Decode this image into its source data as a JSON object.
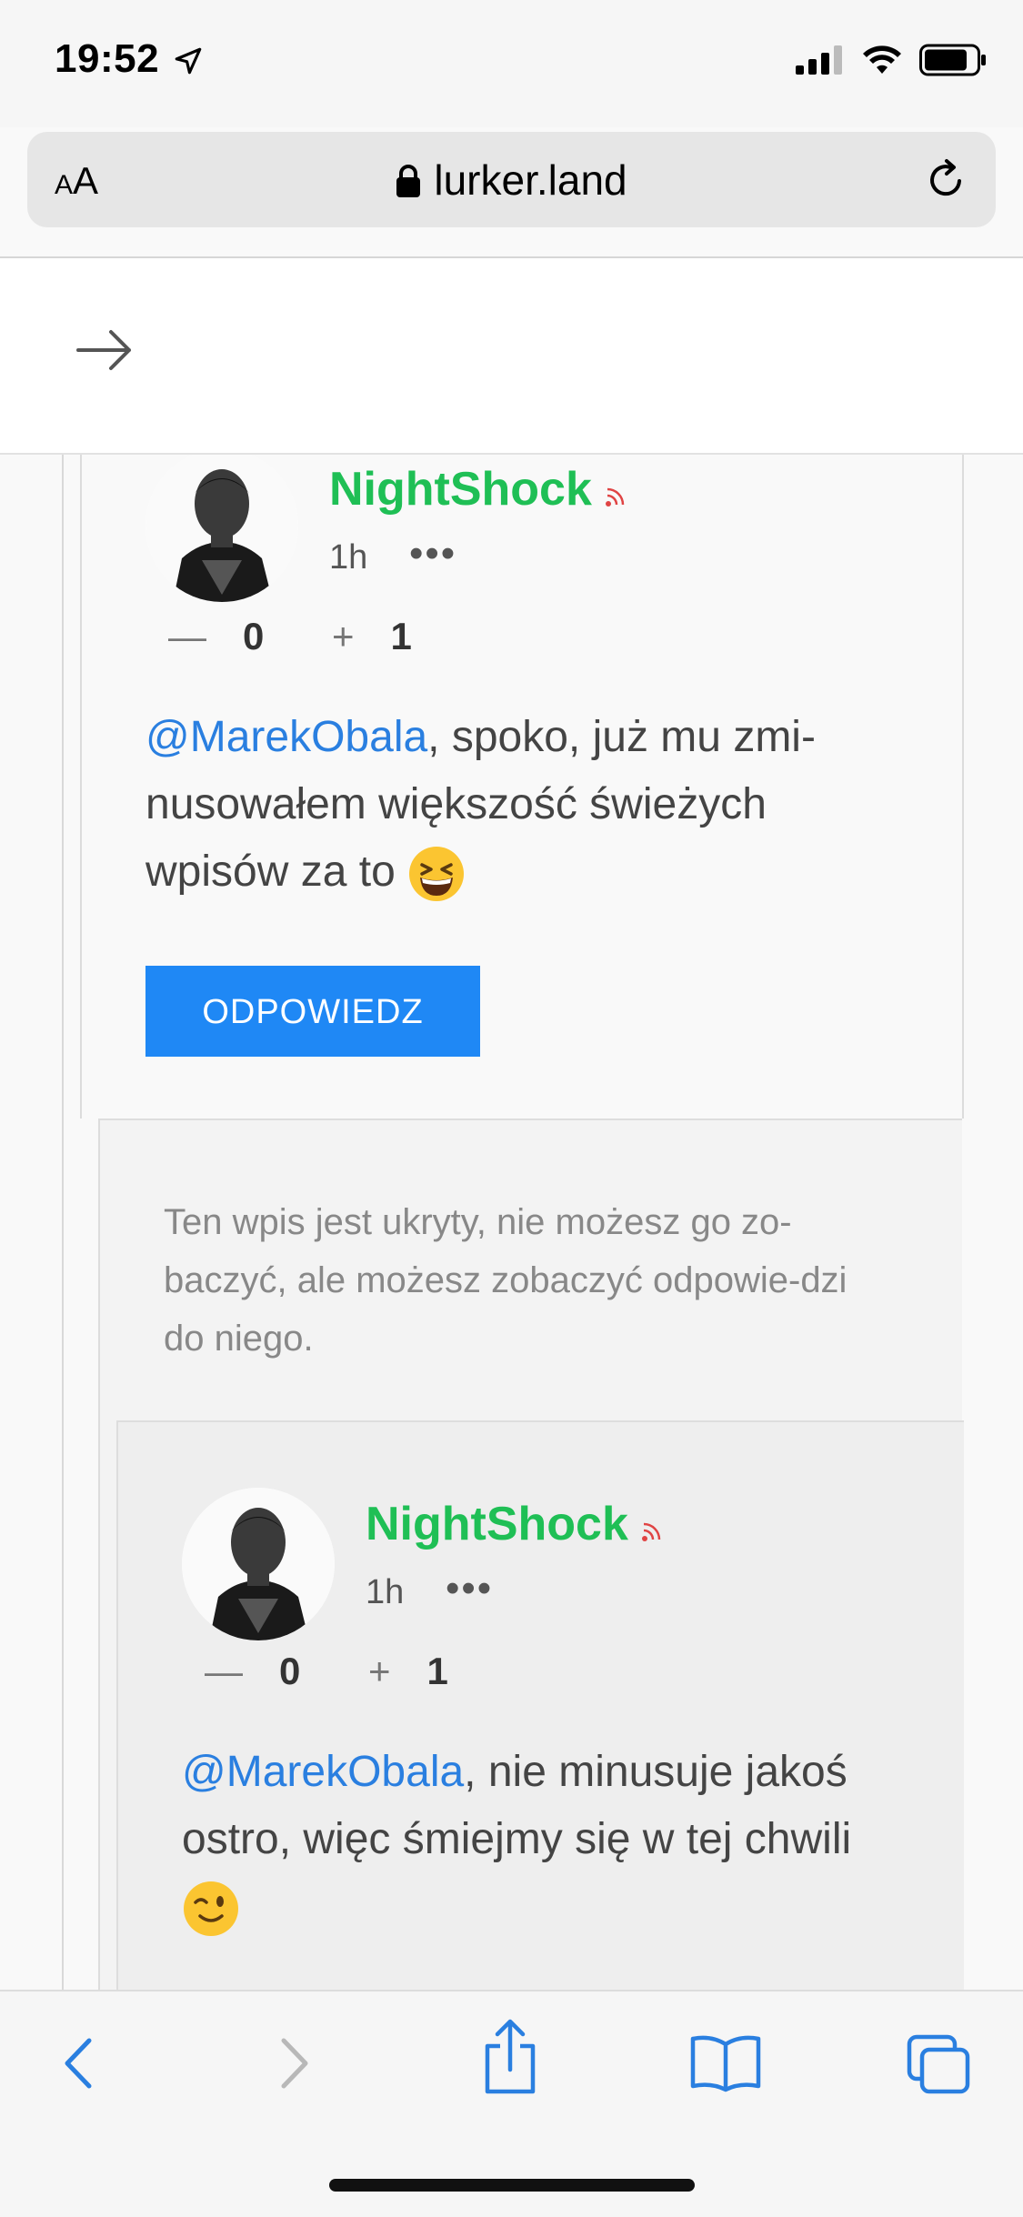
{
  "status_bar": {
    "time": "19:52"
  },
  "url_bar": {
    "aa_label_small": "A",
    "aa_label_large": "A",
    "domain": "lurker.land"
  },
  "posts": [
    {
      "author": "NightShock",
      "time": "1h",
      "more": "•••",
      "minus_symbol": "—",
      "minus_count": "0",
      "plus_symbol": "+",
      "plus_count": "1",
      "mention": "@MarekObala",
      "text": ", spoko, już mu zmi-nusowałem większość świeżych wpisów za to",
      "emoji": "grinning-squinting-face",
      "reply_label": "ODPOWIEDZ"
    },
    {
      "author": "NightShock",
      "time": "1h",
      "more": "•••",
      "minus_symbol": "—",
      "minus_count": "0",
      "plus_symbol": "+",
      "plus_count": "1",
      "mention": "@MarekObala",
      "text": ", nie minusuje jakoś ostro, więc śmiejmy się w tej chwili",
      "emoji": "winking-face"
    }
  ],
  "hidden_notice": "Ten wpis jest ukryty, nie możesz go zo-baczyć, ale możesz zobaczyć odpowie-dzi do niego.",
  "colors": {
    "author": "#1fbf55",
    "mention": "#2a7fe0",
    "button": "#1f88f5",
    "toolbar_icon": "#2a7fe0"
  },
  "toolbar": {
    "icons": [
      "back-icon",
      "forward-icon",
      "share-icon",
      "bookmarks-icon",
      "tabs-icon"
    ]
  }
}
